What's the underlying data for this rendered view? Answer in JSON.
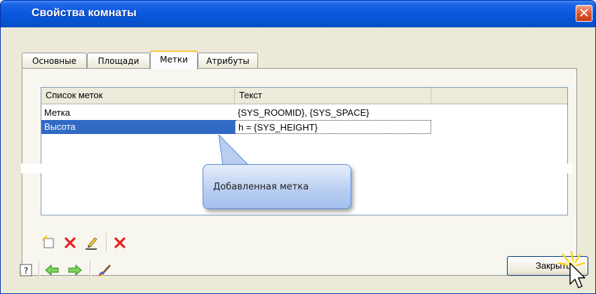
{
  "window": {
    "title": "Свойства комнаты",
    "close_glyph": "✕"
  },
  "tabs": [
    {
      "label": "Основные"
    },
    {
      "label": "Площади"
    },
    {
      "label": "Метки"
    },
    {
      "label": "Атрибуты"
    }
  ],
  "list": {
    "columns": [
      "Список меток",
      "Текст"
    ],
    "rows": [
      {
        "name": "Метка",
        "text": "{SYS_ROOMID}, {SYS_SPACE}"
      },
      {
        "name": "Высота",
        "text": "h = {SYS_HEIGHT}"
      }
    ]
  },
  "callout": {
    "text": "Добавленная метка"
  },
  "buttons": {
    "close": "Закрыть"
  },
  "colors": {
    "title_bar": "#0a58de",
    "selection": "#316ac5",
    "active_tab_accent": "#ffc83c"
  },
  "icons": {
    "list_toolbar": [
      "new-label-icon",
      "delete-icon",
      "edit-icon",
      "delete-all-icon"
    ],
    "bottom_toolbar": [
      "help-icon",
      "prev-arrow-icon",
      "next-arrow-icon",
      "brush-icon"
    ]
  }
}
